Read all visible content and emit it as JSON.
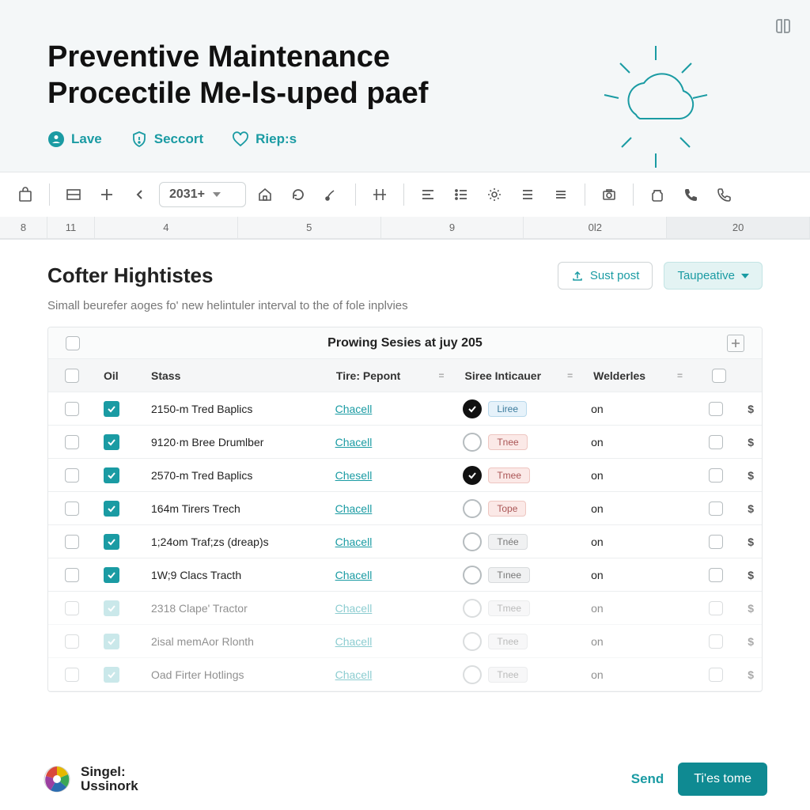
{
  "header": {
    "title_line1": "Preventive Maintenance",
    "title_line2": "Procectile Me-ls-uped paef",
    "crumbs": [
      {
        "label": "Lave"
      },
      {
        "label": "Seccort"
      },
      {
        "label": "Riep:s"
      }
    ]
  },
  "toolbar": {
    "year_value": "2031+"
  },
  "ruler": [
    "8",
    "11",
    "4",
    "5",
    "9",
    "0l2",
    "20"
  ],
  "section": {
    "title": "Cofter Hightistes",
    "subtitle": "Simall beurefer aoges fo' new helintuler interval to the of fole inplvies",
    "action_post": "Sust post",
    "action_taup": "Taupeative"
  },
  "table": {
    "group_header": "Prowing Sesies at juy 205",
    "columns": {
      "oil": "Oil",
      "stass": "Stass",
      "tire": "Tire: Pepont",
      "siree": "Siree Inticauer",
      "weld": "Welderles"
    },
    "rows": [
      {
        "stass": "2150-m Tred Baplics",
        "tire": "Chacell",
        "radio": "dark",
        "pill": "Liree",
        "pill_color": "blue",
        "weld": "on",
        "faded": false
      },
      {
        "stass": "9120·m Bree Drumlber",
        "tire": "Chacell",
        "radio": "empty",
        "pill": "Tnee",
        "pill_color": "red",
        "weld": "on",
        "faded": false
      },
      {
        "stass": "2570-m Tred Baplics",
        "tire": "Chesell",
        "radio": "dark",
        "pill": "Tmee",
        "pill_color": "red",
        "weld": "on",
        "faded": false
      },
      {
        "stass": "164m Tirers Trech",
        "tire": "Chacell",
        "radio": "empty",
        "pill": "Tope",
        "pill_color": "red",
        "weld": "on",
        "faded": false
      },
      {
        "stass": "1;24om Traf;zs (dreap)s",
        "tire": "Chacell",
        "radio": "empty",
        "pill": "Tnée",
        "pill_color": "grey",
        "weld": "on",
        "faded": false
      },
      {
        "stass": "1W;9 Clacs Tracth",
        "tire": "Chacell",
        "radio": "empty",
        "pill": "Tınee",
        "pill_color": "grey",
        "weld": "on",
        "faded": false
      },
      {
        "stass": "2318 Clape' Tractor",
        "tire": "Chacell",
        "radio": "empty",
        "pill": "Tmee",
        "pill_color": "grey",
        "weld": "on",
        "faded": true
      },
      {
        "stass": "2isal memAor Rlonth",
        "tire": "Chacell",
        "radio": "empty",
        "pill": "Tnee",
        "pill_color": "grey",
        "weld": "on",
        "faded": true
      },
      {
        "stass": "Oad Firter Hotlings",
        "tire": "Chacell",
        "radio": "empty",
        "pill": "Tnee",
        "pill_color": "grey",
        "weld": "on",
        "faded": true
      }
    ],
    "dollar": "$"
  },
  "footer": {
    "brand_line1": "Singel:",
    "brand_line2": "Ussinork",
    "send": "Send",
    "primary": "Ti'es tome"
  }
}
